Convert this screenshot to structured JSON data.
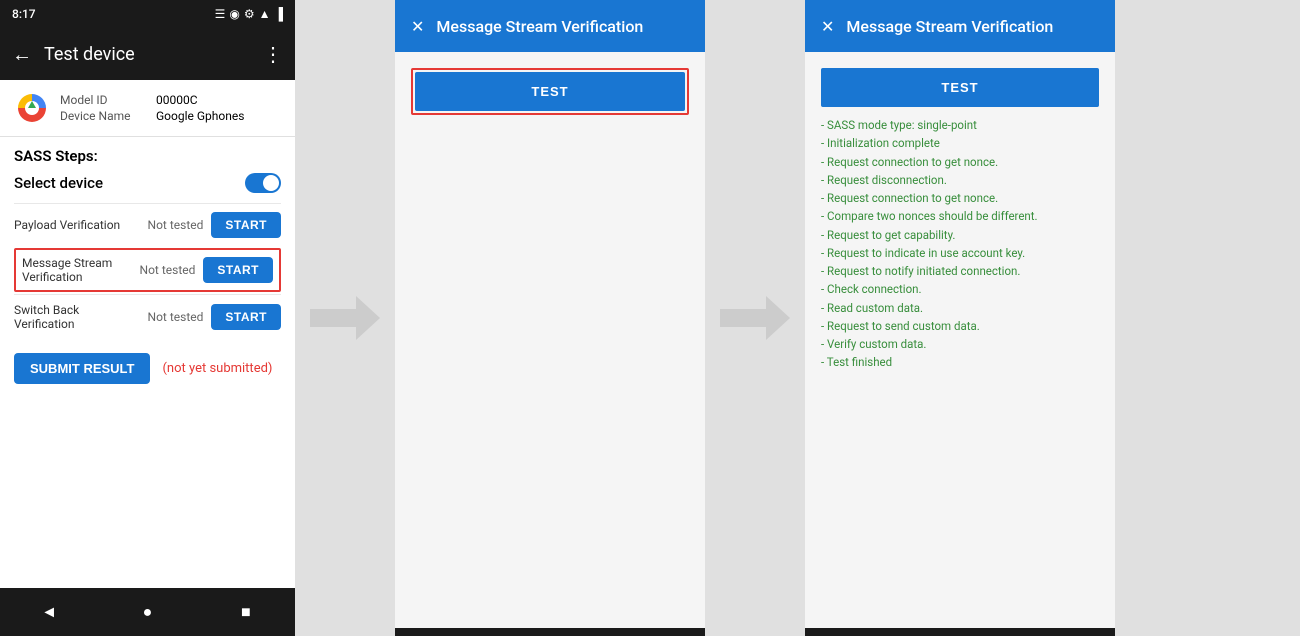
{
  "statusBar": {
    "time": "8:17",
    "icons": [
      "notification",
      "location",
      "settings",
      "wifi",
      "battery"
    ]
  },
  "appBar": {
    "title": "Test device",
    "backIcon": "←",
    "menuIcon": "⋮"
  },
  "deviceInfo": {
    "modelLabel": "Model ID",
    "modelValue": "00000C",
    "nameLabel": "Device Name",
    "nameValue": "Google Gphones"
  },
  "sass": {
    "title": "SASS Steps:",
    "selectDeviceLabel": "Select device"
  },
  "steps": [
    {
      "label": "Payload Verification",
      "status": "Not tested",
      "btnLabel": "START"
    },
    {
      "label": "Message Stream\nVerification",
      "status": "Not tested",
      "btnLabel": "START",
      "highlighted": true
    },
    {
      "label": "Switch Back Verification",
      "status": "Not tested",
      "btnLabel": "START"
    }
  ],
  "submitBtn": "SUBMIT RESULT",
  "notSubmitted": "(not yet submitted)",
  "navButtons": [
    "◄",
    "●",
    "■"
  ],
  "dialog1": {
    "title": "Message Stream Verification",
    "closeIcon": "✕",
    "testBtn": "TEST",
    "hasRedBorder": true
  },
  "dialog2": {
    "title": "Message Stream Verification",
    "closeIcon": "✕",
    "testBtn": "TEST",
    "hasRedBorder": false,
    "logs": [
      {
        "text": "- SASS mode type: single-point",
        "color": "green"
      },
      {
        "text": "- Initialization complete",
        "color": "green"
      },
      {
        "text": "- Request connection to get nonce.",
        "color": "green"
      },
      {
        "text": "- Request disconnection.",
        "color": "green"
      },
      {
        "text": "- Request connection to get nonce.",
        "color": "green"
      },
      {
        "text": "- Compare two nonces should be different.",
        "color": "green"
      },
      {
        "text": "- Request to get capability.",
        "color": "green"
      },
      {
        "text": "- Request to indicate in use account key.",
        "color": "green"
      },
      {
        "text": "- Request to notify initiated connection.",
        "color": "green"
      },
      {
        "text": "- Check connection.",
        "color": "green"
      },
      {
        "text": "- Read custom data.",
        "color": "green"
      },
      {
        "text": "- Request to send custom data.",
        "color": "green"
      },
      {
        "text": "- Verify custom data.",
        "color": "green"
      },
      {
        "text": "- Test finished",
        "color": "green"
      }
    ]
  }
}
